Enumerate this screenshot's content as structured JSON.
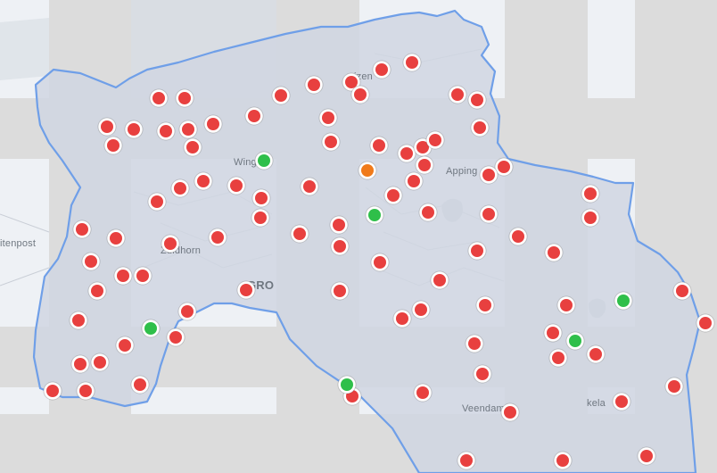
{
  "map": {
    "region_outline_color": "#6f9fe8",
    "region_fill_color": "#d0d6e2",
    "basemap_tile_color": "#eef1f5",
    "unloaded_tile_color": "#dcdcdc",
    "water_color": "#d6dbe3",
    "place_labels": [
      "izen",
      "Wing",
      "Apping",
      "Zuidhorn",
      "itenpost",
      "GRO",
      "Veendam",
      "kela"
    ],
    "marker_status_colors": {
      "red": "#e8403f",
      "green": "#2fbf4a",
      "orange": "#f07a1a"
    },
    "marker_counts": {
      "red": 96,
      "green": 6,
      "orange": 1
    }
  }
}
